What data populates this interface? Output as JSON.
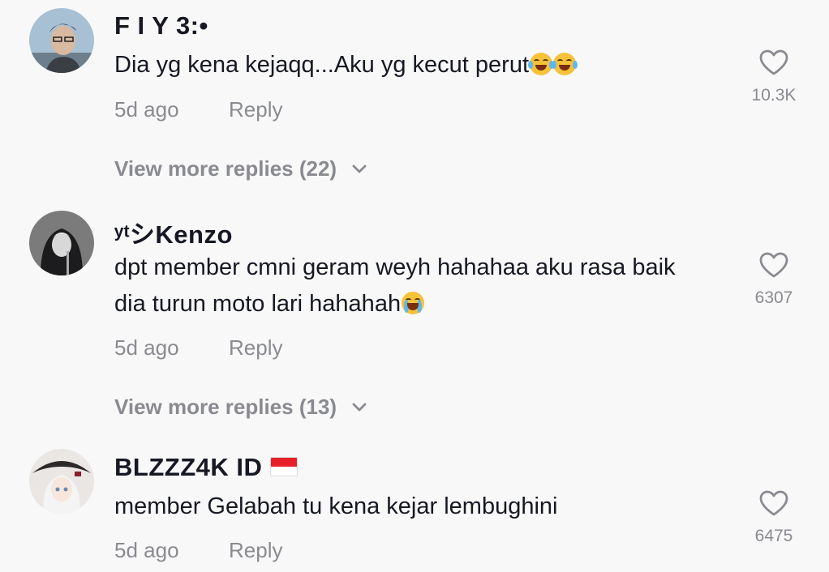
{
  "comments": [
    {
      "username": "F I Y 3:•",
      "text": "Dia yg kena kejaqq...Aku yg kecut perut",
      "emojis": [
        "face-with-tears-of-joy",
        "face-with-tears-of-joy"
      ],
      "time": "5d ago",
      "reply_label": "Reply",
      "likes": "10.3K",
      "view_more": "View more replies (22)",
      "avatar_colors": [
        "#9ab3c9",
        "#3b3434"
      ]
    },
    {
      "username": "ʸᵗシKenzo",
      "text_line1": "dpt member cmni geram weyh hahahaa aku rasa baik",
      "text_line2": "dia turun moto lari hahahah",
      "emojis": [
        "loudly-crying-face"
      ],
      "time": "5d ago",
      "reply_label": "Reply",
      "likes": "6307",
      "view_more": "View more replies (13)",
      "avatar_colors": [
        "#6f6f6f",
        "#1f1f1f"
      ]
    },
    {
      "username": "BLZZZ4K ID",
      "flag": "indonesia-flag",
      "text": "member Gelabah tu kena kejar lembughini",
      "time": "5d ago",
      "reply_label": "Reply",
      "likes": "6475",
      "avatar_colors": [
        "#e9e4e0",
        "#2c2a2b"
      ]
    }
  ],
  "colors": {
    "background": "#f8f8f8",
    "primary_text": "#161823",
    "secondary_text": "#8a8b91"
  }
}
